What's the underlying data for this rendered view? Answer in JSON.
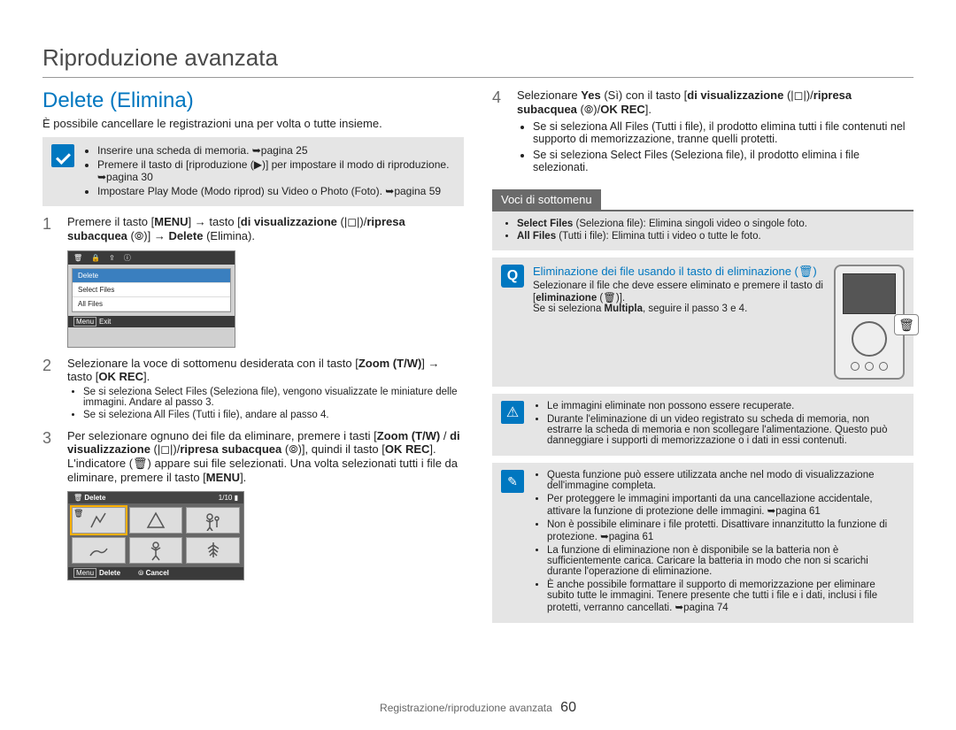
{
  "chapter": "Riproduzione avanzata",
  "section_title": "Delete (Elimina)",
  "intro": "È possibile cancellare le registrazioni una per volta o tutte insieme.",
  "precond": {
    "items": [
      "Inserire una scheda di memoria. ➥pagina 25",
      "Premere il tasto di [riproduzione (▶)] per impostare il modo di riproduzione. ➥pagina 30",
      "Impostare Play Mode (Modo riprod) su Video o Photo (Foto). ➥pagina 59"
    ]
  },
  "steps_left": {
    "s1": {
      "num": "1",
      "text_a": "Premere il tasto [",
      "menu": "MENU",
      "text_b": "] → tasto [",
      "disp": "di visualizzazione",
      "text_c": " (|◻|)/",
      "sub_a": "ripresa subacquea",
      "text_d": " (⦾)] → ",
      "del": "Delete",
      "text_e": " (Elimina)."
    },
    "s2": {
      "num": "2",
      "text_a": "Selezionare la voce di sottomenu desiderata con il tasto [",
      "zoom": "Zoom (T/W)",
      "text_b": "] → tasto [",
      "okrec": "OK REC",
      "text_c": "].",
      "sub": [
        "Se si seleziona Select Files (Seleziona file), vengono visualizzate le miniature delle immagini. Andare al passo 3.",
        "Se si seleziona All Files (Tutti i file), andare al passo 4."
      ]
    },
    "s3": {
      "num": "3",
      "text_a": "Per selezionare ognuno dei file da eliminare, premere i tasti [",
      "zoom": "Zoom (T/W)",
      "sep": " / ",
      "disp": "di visualizzazione",
      "text_b": " (|◻|)/",
      "sub_a": "ripresa subacquea",
      "text_c": " (⦾)], quindi il tasto [",
      "okrec": "OK REC",
      "text_d": "]. L'indicatore (🗑) appare sui file selezionati. Una volta selezionati tutti i file da eliminare, premere il tasto [",
      "menu": "MENU",
      "text_e": "]."
    }
  },
  "screenshot1": {
    "tab_delete": "Delete",
    "item_sel": "Select Files",
    "item_all": "All Files",
    "foot": "Exit",
    "menu_label": "Menu"
  },
  "screenshot2": {
    "title": "Delete",
    "counter": "1/10",
    "foot_delete": "Delete",
    "foot_cancel": "Cancel",
    "menu_label": "Menu"
  },
  "step4": {
    "num": "4",
    "text_a": "Selezionare ",
    "yes": "Yes",
    "text_b": " (Sì) con il tasto [",
    "disp": "di visualizzazione",
    "text_c": " (|◻|)/",
    "sub_a": "ripresa subacquea",
    "text_d": " (⦾)/",
    "okrec": "OK REC",
    "text_e": "].",
    "bullets": [
      "Se si seleziona All Files (Tutti i file), il prodotto elimina tutti i file contenuti nel supporto di memorizzazione, tranne quelli protetti.",
      "Se si seleziona Select Files (Seleziona file), il prodotto elimina i file selezionati."
    ]
  },
  "submenu": {
    "label": "Voci di sottomenu",
    "items": [
      {
        "head": "Select Files",
        "paren": " (Seleziona file): Elimina singoli video o singole foto."
      },
      {
        "head": "All Files",
        "paren": " (Tutti i file): Elimina tutti i video o tutte le foto."
      }
    ]
  },
  "tip_delete": {
    "title": "Eliminazione dei file usando il tasto di eliminazione (🗑)",
    "line1": "Selezionare il file che deve essere eliminato e premere il tasto di [",
    "bold1": "eliminazione",
    "line1b": " (🗑)].",
    "line2a": "Se si seleziona ",
    "bold2": "Multipla",
    "line2b": ", seguire il passo 3 e 4."
  },
  "warn_box": {
    "items": [
      "Le immagini eliminate non possono essere recuperate.",
      "Durante l'eliminazione di un video registrato su scheda di memoria, non estrarre la scheda di memoria e non scollegare l'alimentazione. Questo può danneggiare i supporti di memorizzazione o i dati in essi contenuti."
    ]
  },
  "note_box": {
    "items": [
      "Questa funzione può essere utilizzata anche nel modo di visualizzazione dell'immagine completa.",
      "Per proteggere le immagini importanti da una cancellazione accidentale, attivare la funzione di protezione delle immagini. ➥pagina 61",
      "Non è possibile eliminare i file protetti. Disattivare innanzitutto la funzione di protezione. ➥pagina 61",
      "La funzione di eliminazione non è disponibile se la batteria non è sufficientemente carica. Caricare la batteria in modo che non si scarichi durante l'operazione di eliminazione.",
      "È anche possibile formattare il supporto di memorizzazione per eliminare subito tutte le immagini. Tenere presente che tutti i file e i dati, inclusi i file protetti, verranno cancellati. ➥pagina 74"
    ]
  },
  "footer": {
    "text": "Registrazione/riproduzione avanzata",
    "page": "60"
  }
}
